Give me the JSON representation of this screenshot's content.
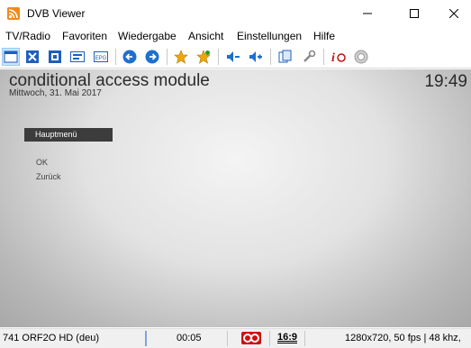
{
  "window": {
    "title": "DVB Viewer"
  },
  "menu": [
    "TV/Radio",
    "Favoriten",
    "Wiedergabe",
    "Ansicht",
    "Einstellungen",
    "Hilfe"
  ],
  "toolbar": {
    "icons": [
      "window-mode-icon",
      "fullscreen-icon",
      "teletext-icon",
      "osd-icon",
      "epg-icon",
      "back-icon",
      "forward-icon",
      "favorite-icon",
      "favorite-add-icon",
      "volume-down-icon",
      "volume-up-icon",
      "copy-icon",
      "tools-icon",
      "info-icon",
      "record-icon"
    ],
    "epg_label": "EPG"
  },
  "osd": {
    "title": "conditional access module",
    "date": "Mittwoch, 31. Mai 2017",
    "clock": "19:49",
    "menu_header": "Hauptmenü",
    "items": [
      "OK",
      "Zurück"
    ]
  },
  "status": {
    "channel": "741 ORF2O HD (deu)",
    "time": "00:05",
    "aspect": "16:9",
    "video_info": "1280x720, 50 fps | 48 khz,"
  },
  "colors": {
    "record_icon": "#cc1111",
    "nav_blue": "#1e6fcf",
    "star": "#f0a800"
  }
}
